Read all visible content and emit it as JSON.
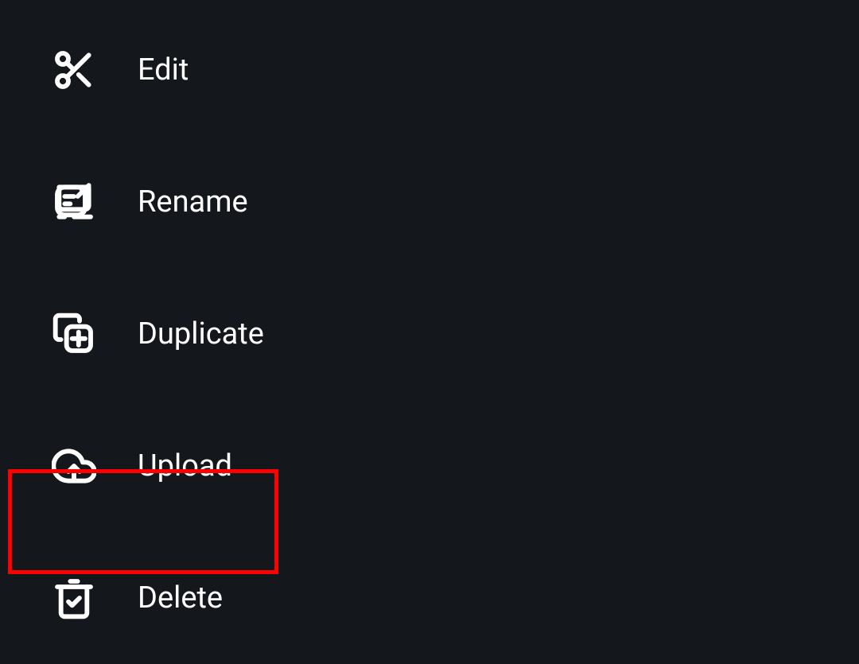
{
  "menu": {
    "items": [
      {
        "label": "Edit"
      },
      {
        "label": "Rename"
      },
      {
        "label": "Duplicate"
      },
      {
        "label": "Upload"
      },
      {
        "label": "Delete"
      }
    ]
  }
}
